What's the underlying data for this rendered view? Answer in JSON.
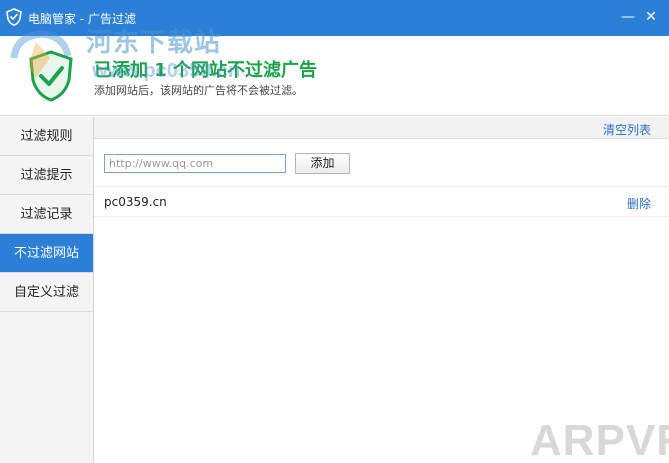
{
  "window": {
    "title": "电脑管家 - 广告过滤",
    "minimize_symbol": "—",
    "close_symbol": "✕"
  },
  "header": {
    "headline": "已添加 1 个网站不过滤广告",
    "subtitle": "添加网站后，该网站的广告将不会被过滤。"
  },
  "watermarks": {
    "site_name": "河东下载站",
    "site_url": "www.pc0359.cn",
    "corner": "ARPVR"
  },
  "sidebar": {
    "items": [
      {
        "label": "过滤规则"
      },
      {
        "label": "过滤提示"
      },
      {
        "label": "过滤记录"
      },
      {
        "label": "不过滤网站"
      },
      {
        "label": "自定义过滤"
      }
    ],
    "active_index": 3
  },
  "main": {
    "clear_label": "清空列表",
    "input_placeholder": "http://www.qq.com",
    "input_value": "",
    "add_label": "添加",
    "sites": [
      {
        "domain": "pc0359.cn",
        "delete_label": "删除"
      }
    ]
  },
  "colors": {
    "accent": "#2b7fd6",
    "headline_green": "#1aa34a",
    "link_blue": "#2b6fc4"
  }
}
